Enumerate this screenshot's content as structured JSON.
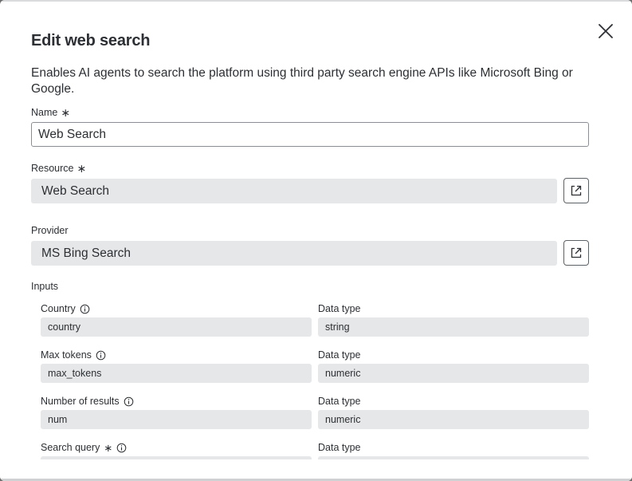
{
  "dialog": {
    "title": "Edit web search",
    "description": "Enables AI agents to search the platform using third party search engine APIs like Microsoft Bing or Google."
  },
  "name_field": {
    "label": "Name",
    "required_mark": "∗",
    "value": "Web Search"
  },
  "resource_field": {
    "label": "Resource",
    "required_mark": "∗",
    "value": "Web Search"
  },
  "provider_field": {
    "label": "Provider",
    "value": "MS Bing Search"
  },
  "inputs": {
    "section_label": "Inputs",
    "rows": [
      {
        "label": "Country",
        "required_mark": "",
        "value": "country",
        "type_label": "Data type",
        "type_value": "string"
      },
      {
        "label": "Max tokens",
        "required_mark": "",
        "value": "max_tokens",
        "type_label": "Data type",
        "type_value": "numeric"
      },
      {
        "label": "Number of results",
        "required_mark": "",
        "value": "num",
        "type_label": "Data type",
        "type_value": "numeric"
      },
      {
        "label": "Search query",
        "required_mark": "∗",
        "value": "",
        "type_label": "Data type",
        "type_value": ""
      }
    ]
  },
  "icons": {
    "close": "close-icon",
    "external_link": "external-link-icon",
    "info": "info-icon"
  }
}
